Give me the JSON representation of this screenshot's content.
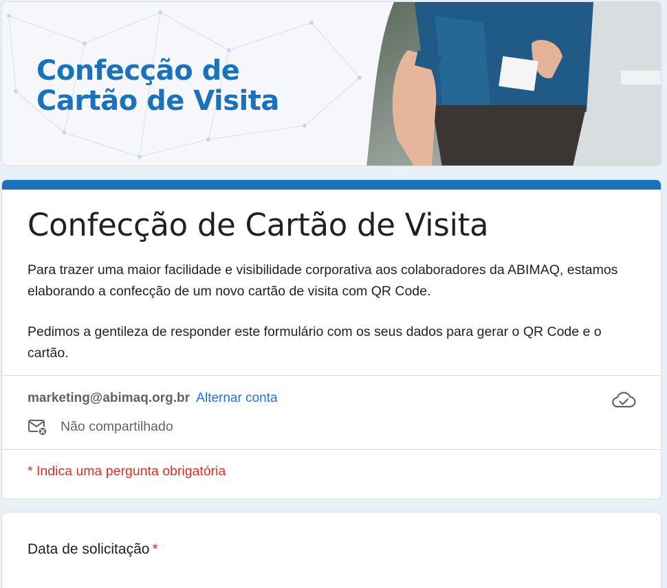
{
  "banner": {
    "title_line1": "Confecção de",
    "title_line2": "Cartão de Visita",
    "photo_alt": "business-card-handshake-photo"
  },
  "form": {
    "title": "Confecção de Cartão de Visita",
    "description_p1": "Para trazer uma maior facilidade e visibilidade corporativa aos colaboradores da ABIMAQ, estamos elaborando a confecção de um novo cartão de visita com QR Code.",
    "description_p2": "Pedimos a gentileza de responder este formulário com os seus dados para gerar o QR Code e o cartão.",
    "accent_color": "#1a72bb"
  },
  "account": {
    "email": "marketing@abimaq.org.br",
    "switch_label": "Alternar conta",
    "shared_status": "Não compartilhado",
    "cloud_icon": "cloud-check-icon",
    "mail_icon": "mail-not-shared-icon"
  },
  "required_note": "* Indica uma pergunta obrigatória",
  "question": {
    "label": "Data de solicitação",
    "required_mark": "*"
  },
  "colors": {
    "brand_blue": "#1a72bb",
    "link_blue": "#1a73e8",
    "required_red": "#d93025",
    "page_bg": "#e8f1f8"
  }
}
